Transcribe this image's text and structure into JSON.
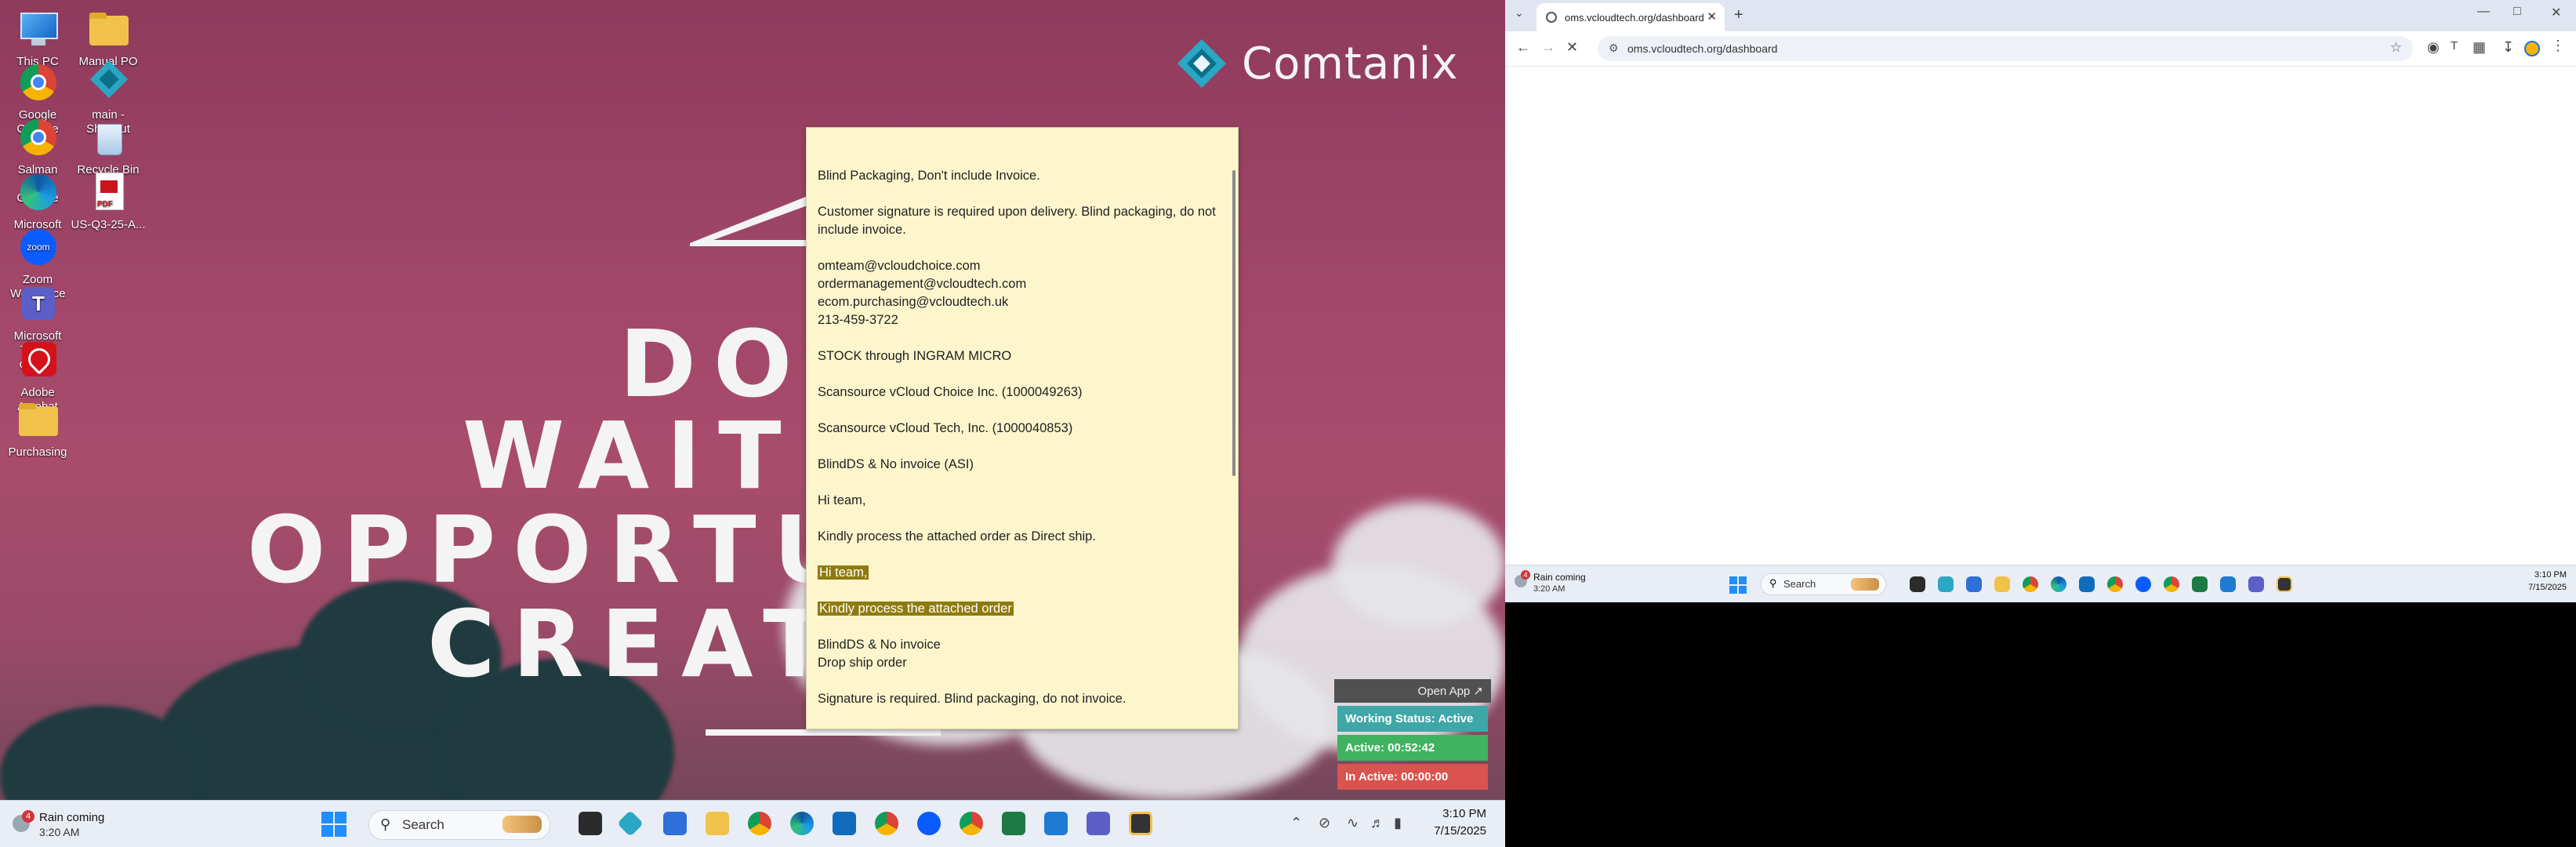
{
  "desktop": {
    "brand": "Comtanix",
    "wallpaper_lines": [
      "DON",
      "WAIT FO",
      "OPPORTUNIT",
      "CREATE"
    ],
    "icons": [
      {
        "label": "This PC",
        "icon": "pc-icon"
      },
      {
        "label": "Manual PO",
        "icon": "folder-icon"
      },
      {
        "label": "Google Chrome",
        "icon": "chrome-icon"
      },
      {
        "label": "main - Shortcut",
        "icon": "app-icon"
      },
      {
        "label": "Salman Ali - Chrome",
        "icon": "chrome-icon"
      },
      {
        "label": "Recycle Bin",
        "icon": "recycle-bin-icon"
      },
      {
        "label": "Microsoft Edge",
        "icon": "edge-icon"
      },
      {
        "label": "US-Q3-25-A...",
        "icon": "pdf-icon"
      },
      {
        "label": "Zoom Workplace",
        "icon": "zoom-icon"
      },
      {
        "label": "Microsoft Teams class...",
        "icon": "teams-icon"
      },
      {
        "label": "Adobe Acrobat",
        "icon": "acrobat-icon"
      },
      {
        "label": "Purchasing",
        "icon": "folder-icon"
      }
    ]
  },
  "sticky_note": {
    "paragraphs": [
      "Blind Packaging, Don't include Invoice.",
      "Customer signature is required upon delivery. Blind packaging, do not include invoice.",
      "omteam@vcloudchoice.com\nordermanagement@vcloudtech.com\necom.purchasing@vcloudtech.uk\n 213-459-3722",
      "STOCK through INGRAM MICRO",
      "Scansource vCloud Choice Inc. (1000049263)",
      "Scansource vCloud Tech, Inc. (1000040853)",
      "BlindDS & No invoice (ASI)",
      "Hi team,",
      "Kindly process the attached order as Direct ship."
    ],
    "highlighted": [
      "Hi team,",
      "Kindly process the attached order"
    ],
    "after": [
      "BlindDS & No invoice\nDrop ship order",
      "Signature is required. Blind packaging, do not invoice."
    ]
  },
  "tracker": {
    "open_app": "Open App ↗",
    "status": "Working Status: Active",
    "active": "Active: 00:52:42",
    "inactive": "In Active: 00:00:00",
    "colors": {
      "status": "#3fa7a7",
      "active": "#3fb35f",
      "inactive": "#d9534f"
    }
  },
  "taskbar_left": {
    "weather_title": "Rain coming",
    "weather_time": "3:20 AM",
    "weather_badge": "4",
    "search": "Search",
    "time": "3:10 PM",
    "date": "7/15/2025"
  },
  "browser": {
    "tab_title": "oms.vcloudtech.org/dashboard",
    "url": "oms.vcloudtech.org/dashboard"
  },
  "taskbar_right": {
    "weather_title": "Rain coming",
    "weather_time": "3:20 AM",
    "weather_badge": "4",
    "search": "Search",
    "time": "3:10 PM",
    "date": "7/15/2025"
  }
}
